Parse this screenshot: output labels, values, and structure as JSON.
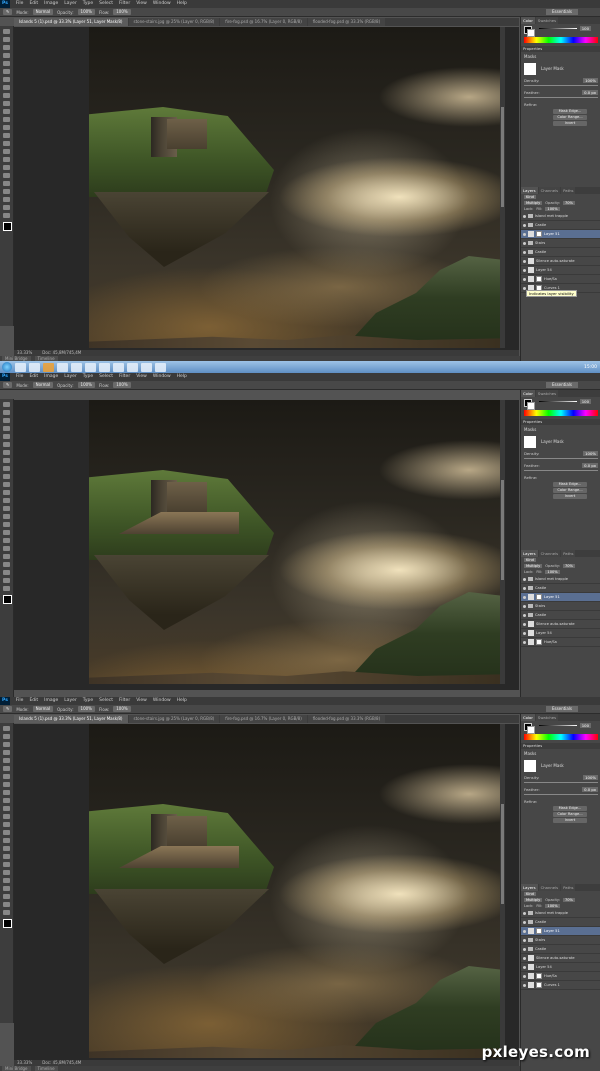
{
  "menu": {
    "app_logo": "Ps",
    "items": [
      "File",
      "Edit",
      "Image",
      "Layer",
      "Type",
      "Select",
      "Filter",
      "View",
      "Window",
      "Help"
    ]
  },
  "options": {
    "mode_label": "Mode:",
    "mode_value": "Normal",
    "opacity_label": "Opacity:",
    "opacity_value": "100%",
    "flow_label": "Flow:",
    "flow_value": "100%",
    "workspace": "Essentials"
  },
  "doc_tabs": [
    "Islands 5 (1).psd @ 33.3% (Layer 51, Layer Mask/8)",
    "stone-stairs.jpg @ 25% (Layer 0, RGB/8)",
    "fire-fog.psd @ 16.7% (Layer 0, RGB/8)",
    "flooded-fog.psd @ 33.3% (RGB/8)"
  ],
  "status": {
    "zoom": "33.33%",
    "doc": "Doc: 45,8M/745,4M"
  },
  "bridge_tabs": [
    "Mini Bridge",
    "Timeline"
  ],
  "panels": {
    "color_tabs": [
      "Color",
      "Swatches"
    ],
    "color_value": "100",
    "properties_header": "Properties",
    "masks_label": "Masks",
    "layer_mask_label": "Layer Mask",
    "density_label": "Density:",
    "density_value": "100%",
    "feather_label": "Feather:",
    "feather_value": "0.0 px",
    "refine_label": "Refine:",
    "mask_edge": "Mask Edge...",
    "color_range": "Color Range...",
    "invert": "Invert",
    "layers_tabs": [
      "Layers",
      "Channels",
      "Paths"
    ],
    "kind": "Kind",
    "blend": "Multiply",
    "opacity_label": "Opacity:",
    "opacity_value": "70%",
    "lock_label": "Lock:",
    "fill_label": "Fill:",
    "fill_value": "100%"
  },
  "layers_top": [
    {
      "name": "Island met trappie",
      "type": "group"
    },
    {
      "name": "Castle",
      "type": "group"
    },
    {
      "name": "Layer 51",
      "type": "layer",
      "selected": true
    },
    {
      "name": "Stairs",
      "type": "group"
    },
    {
      "name": "Castle",
      "type": "group"
    },
    {
      "name": "Silence auto-saturate",
      "type": "layer"
    },
    {
      "name": "Layer 54",
      "type": "layer"
    },
    {
      "name": "Hue/Sa",
      "type": "adj"
    },
    {
      "name": "Curves 1",
      "type": "adj"
    }
  ],
  "layers_mid": [
    {
      "name": "Island met trappie",
      "type": "group"
    },
    {
      "name": "Castle",
      "type": "group"
    },
    {
      "name": "Layer 51",
      "type": "layer",
      "selected": true
    },
    {
      "name": "Stairs",
      "type": "group"
    },
    {
      "name": "Castle",
      "type": "group"
    },
    {
      "name": "Silence auto-saturate",
      "type": "layer"
    },
    {
      "name": "Layer 54",
      "type": "layer"
    },
    {
      "name": "Hue/Sa",
      "type": "adj"
    }
  ],
  "layers_bot": [
    {
      "name": "Island met trappie",
      "type": "group"
    },
    {
      "name": "Castle",
      "type": "group"
    },
    {
      "name": "Layer 51",
      "type": "layer",
      "selected": true
    },
    {
      "name": "Stairs",
      "type": "group"
    },
    {
      "name": "Castle",
      "type": "group"
    },
    {
      "name": "Silence auto-saturate",
      "type": "layer"
    },
    {
      "name": "Layer 54",
      "type": "layer"
    },
    {
      "name": "Hue/Sa",
      "type": "adj"
    },
    {
      "name": "Curves 1",
      "type": "adj"
    }
  ],
  "tooltip": "Indicates layer visibility",
  "clock": "15:00",
  "watermark": "pxleyes.com"
}
